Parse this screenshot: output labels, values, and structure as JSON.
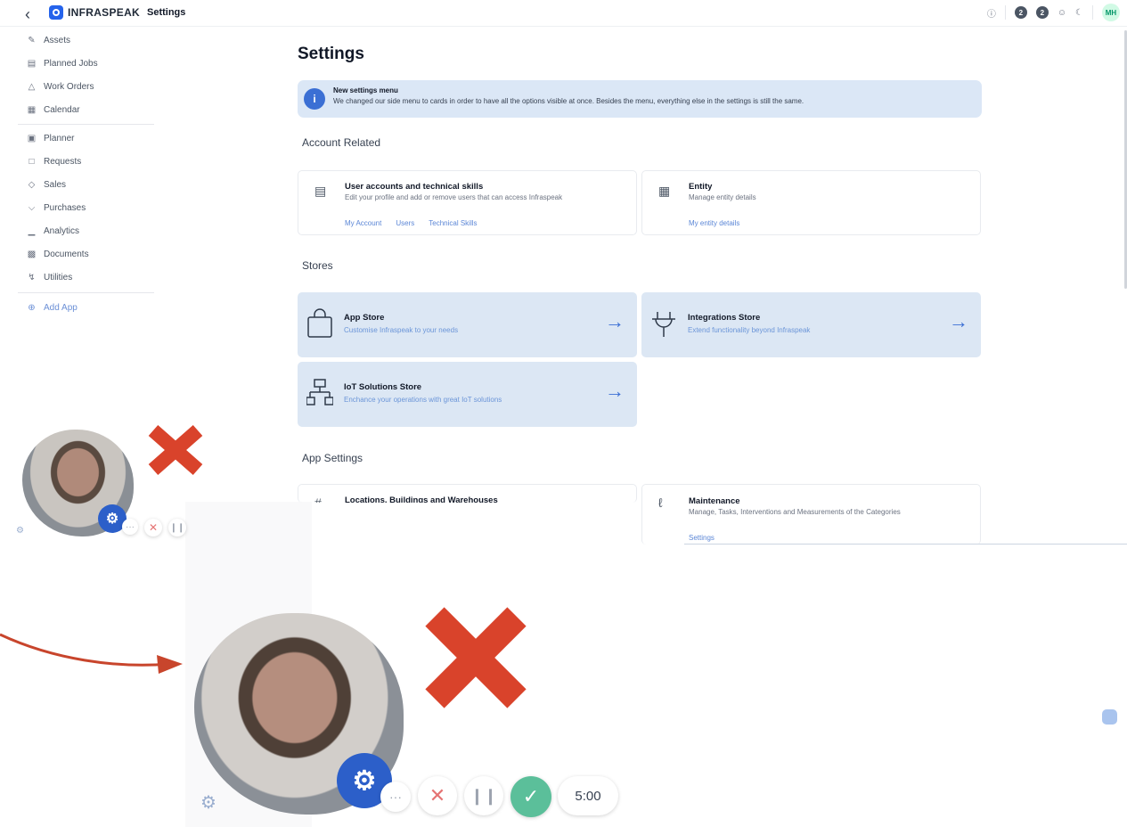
{
  "topbar": {
    "brand": "INFRASPEAK",
    "page": "Settings",
    "notif_counts": [
      "2",
      "2"
    ],
    "user_initials": "MH"
  },
  "sidebar": {
    "items": [
      {
        "label": "Assets",
        "icon": "wrench-icon"
      },
      {
        "label": "Planned Jobs",
        "icon": "clipboard-icon"
      },
      {
        "label": "Work Orders",
        "icon": "warning-icon"
      },
      {
        "label": "Calendar",
        "icon": "calendar-icon"
      },
      {
        "label": "Planner",
        "icon": "planner-icon"
      },
      {
        "label": "Requests",
        "icon": "chat-icon"
      },
      {
        "label": "Sales",
        "icon": "tag-icon"
      },
      {
        "label": "Purchases",
        "icon": "cart-icon"
      },
      {
        "label": "Analytics",
        "icon": "bar-chart-icon"
      },
      {
        "label": "Documents",
        "icon": "document-icon"
      },
      {
        "label": "Utilities",
        "icon": "bolt-icon"
      }
    ],
    "add_app": "Add App"
  },
  "main": {
    "title": "Settings",
    "banner": {
      "title": "New settings menu",
      "text": "We changed our side menu to cards in order to have all the options visible at once. Besides the menu, everything else in the settings is still the same."
    },
    "account_related": {
      "heading": "Account Related",
      "cards": [
        {
          "title": "User accounts and technical skills",
          "desc": "Edit your profile and add or remove users that can access Infraspeak",
          "links": [
            "My Account",
            "Users",
            "Technical Skills"
          ]
        },
        {
          "title": "Entity",
          "desc": "Manage entity details",
          "links": [
            "My entity details"
          ]
        }
      ]
    },
    "stores": {
      "heading": "Stores",
      "cards": [
        {
          "title": "App Store",
          "desc": "Customise Infraspeak to your needs"
        },
        {
          "title": "Integrations Store",
          "desc": "Extend functionality beyond Infraspeak"
        },
        {
          "title": "IoT Solutions Store",
          "desc": "Enchance your operations with great IoT solutions"
        }
      ]
    },
    "app_settings": {
      "heading": "App Settings",
      "cards": [
        {
          "title": "Locations, Buildings and Warehouses"
        },
        {
          "title": "Maintenance",
          "desc": "Manage, Tasks, Interventions and Measurements of the Categories",
          "links": [
            "Settings"
          ]
        }
      ]
    }
  },
  "recorder": {
    "timer": "5:00",
    "colors": {
      "accent": "#2c5fc9",
      "confirm": "#5bbf9a",
      "cancel_mark": "#d9432b"
    }
  }
}
